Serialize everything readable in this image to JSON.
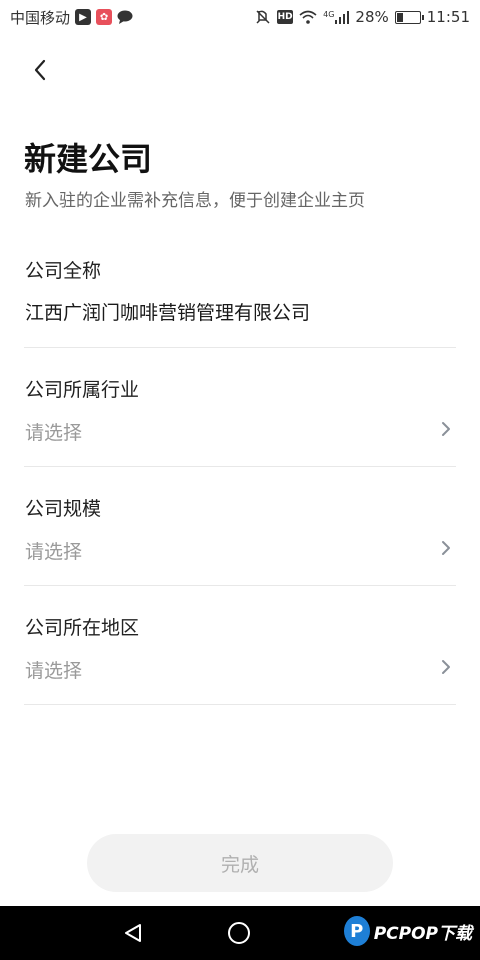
{
  "status_bar": {
    "carrier": "中国移动",
    "network": "4G",
    "battery": "28%",
    "battery_level": 0.28,
    "time": "11:51",
    "hd": "HD"
  },
  "header": {
    "title": "新建公司",
    "subtitle": "新入驻的企业需补充信息，便于创建企业主页"
  },
  "form": {
    "company_name": {
      "label": "公司全称",
      "value": "江西广润门咖啡营销管理有限公司"
    },
    "industry": {
      "label": "公司所属行业",
      "placeholder": "请选择"
    },
    "scale": {
      "label": "公司规模",
      "placeholder": "请选择"
    },
    "region": {
      "label": "公司所在地区",
      "placeholder": "请选择"
    }
  },
  "actions": {
    "done_label": "完成"
  },
  "watermark": {
    "text": "PCPOP下载",
    "logo_letter": "P"
  },
  "colors": {
    "placeholder": "#9a9a9a",
    "button_bg": "#f2f2f2",
    "button_text": "#b0b0b0",
    "watermark_blue": "#1e7fd6"
  }
}
